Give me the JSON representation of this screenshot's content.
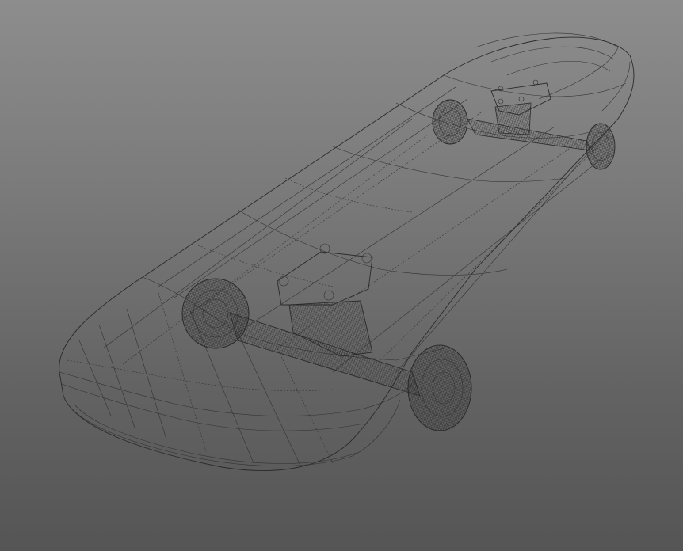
{
  "scene": {
    "subject": "skateboard-wireframe",
    "background_top": "#8d8d8d",
    "background_bottom": "#555555",
    "wire_color": "#2b2b2b"
  }
}
